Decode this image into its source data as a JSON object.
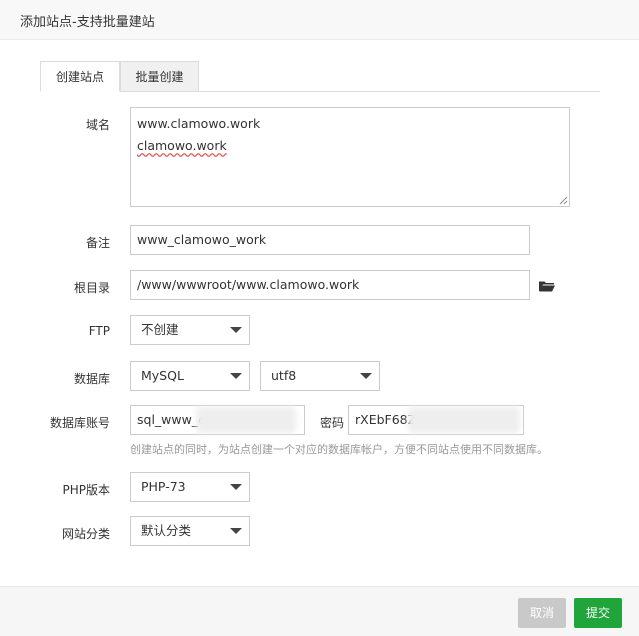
{
  "dialog": {
    "title": "添加站点-支持批量建站"
  },
  "tabs": [
    {
      "label": "创建站点",
      "active": true
    },
    {
      "label": "批量创建",
      "active": false
    }
  ],
  "form": {
    "domain": {
      "label": "域名",
      "lines": [
        "www.clamowo.work",
        "clamowo.work"
      ]
    },
    "remark": {
      "label": "备注",
      "value": "www_clamowo_work"
    },
    "root_dir": {
      "label": "根目录",
      "value": "/www/wwwroot/www.clamowo.work",
      "icon": "folder-open-icon"
    },
    "ftp": {
      "label": "FTP",
      "selected": "不创建"
    },
    "database": {
      "label": "数据库",
      "type_selected": "MySQL",
      "charset_selected": "utf8"
    },
    "db_account": {
      "label": "数据库账号",
      "username_visible": "sql_www_c",
      "password_label": "密码",
      "password_visible": "rXEbF68Z",
      "hint": "创建站点的同时，为站点创建一个对应的数据库帐户，方便不同站点使用不同数据库。"
    },
    "php": {
      "label": "PHP版本",
      "selected": "PHP-73"
    },
    "category": {
      "label": "网站分类",
      "selected": "默认分类"
    }
  },
  "footer": {
    "cancel_label": "取消",
    "submit_label": "提交"
  },
  "colors": {
    "primary": "#20a53a",
    "cancel": "#c9c9c9",
    "border": "#cccccc",
    "hint": "#999999"
  }
}
